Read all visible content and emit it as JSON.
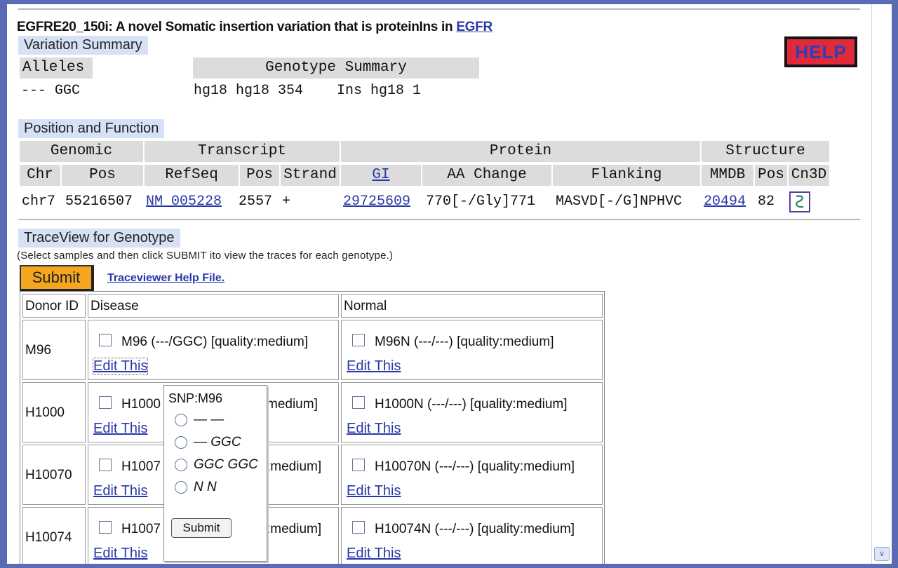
{
  "title": {
    "prefix": "EGFRE20_150i: A novel Somatic insertion variation that is proteinIns in ",
    "gene_link": "EGFR"
  },
  "help_button": "HELP",
  "variation_summary": {
    "section": "Variation Summary",
    "alleles_header": "Alleles",
    "alleles_value": "--- GGC",
    "genotype_header": "Genotype Summary",
    "genotype_value": "hg18 hg18 354    Ins hg18 1"
  },
  "position_function": {
    "section": "Position and Function",
    "groups": {
      "genomic": "Genomic",
      "transcript": "Transcript",
      "protein": "Protein",
      "structure": "Structure"
    },
    "columns": {
      "chr": "Chr",
      "pos": "Pos",
      "refseq": "RefSeq",
      "tpos": "Pos",
      "strand": "Strand",
      "gi": "GI",
      "aa_change": "AA Change",
      "flanking": "Flanking",
      "mmdb": "MMDB",
      "spos": "Pos",
      "cn3d": "Cn3D"
    },
    "row": {
      "chr": "chr7",
      "pos": "55216507",
      "refseq": "NM 005228",
      "tpos": "2557",
      "strand": "+",
      "gi": "29725609",
      "aa_change": "770[-/Gly]771",
      "flanking": "MASVD[-/G]NPHVC",
      "mmdb": "20494",
      "spos": "82"
    }
  },
  "traceview": {
    "section": "TraceView for Genotype",
    "note": "(Select samples and then click SUBMIT ito view the traces for each genotype.)",
    "submit_label": "Submit",
    "help_link": "Traceviewer Help File.",
    "headers": {
      "donor": "Donor ID",
      "disease": "Disease",
      "normal": "Normal"
    },
    "edit_label": "Edit This",
    "rows": [
      {
        "donor": "M96",
        "disease": "M96 (---/GGC) [quality:medium]",
        "normal": "M96N (---/---) [quality:medium]"
      },
      {
        "donor": "H1000",
        "disease": "H1000",
        "disease_tail": "medium]",
        "normal": "H1000N (---/---) [quality:medium]"
      },
      {
        "donor": "H10070",
        "disease": "H1007",
        "disease_tail": ":medium]",
        "normal": "H10070N (---/---) [quality:medium]"
      },
      {
        "donor": "H10074",
        "disease": "H1007",
        "disease_tail": ":medium]",
        "normal": "H10074N (---/---) [quality:medium]"
      }
    ]
  },
  "popup": {
    "title": "SNP:M96",
    "options": [
      "— —",
      "— GGC",
      "GGC GGC",
      "N N"
    ],
    "submit": "Submit"
  }
}
